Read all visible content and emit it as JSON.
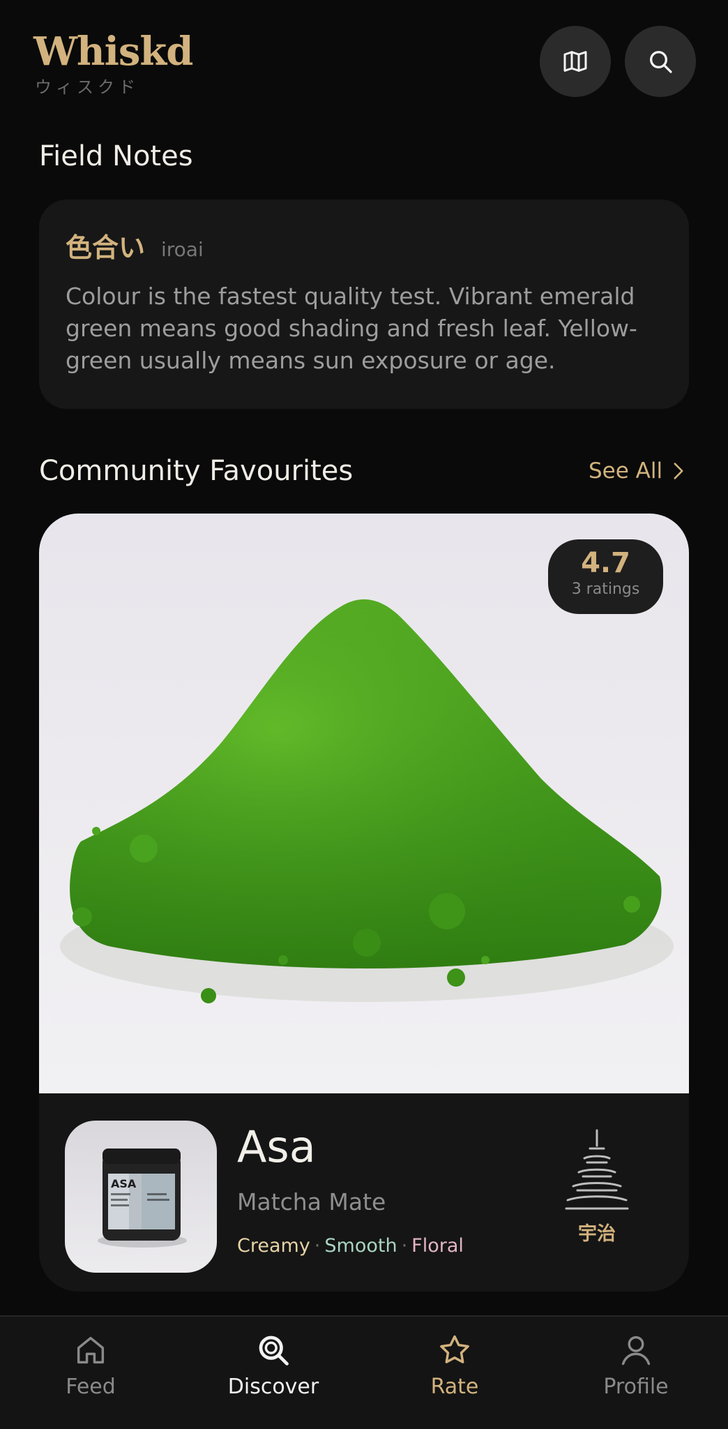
{
  "header": {
    "logo": "Whiskd",
    "logo_sub": "ウィスクド",
    "map_icon": "map-icon",
    "search_icon": "search-icon"
  },
  "field_notes": {
    "title": "Field Notes",
    "note": {
      "term": "色合い",
      "romaji": "iroai",
      "body": "Colour is the fastest quality test. Vibrant emerald green means good shading and fresh leaf. Yellow-green usually means sun exposure or age."
    }
  },
  "community": {
    "title": "Community Favourites",
    "see_all": "See All",
    "featured": {
      "rating": "4.7",
      "ratings_count": "3 ratings",
      "name": "Asa",
      "brand": "Matcha Mate",
      "tags": [
        {
          "label": "Creamy",
          "color": "#e6d3a6"
        },
        {
          "label": "Smooth",
          "color": "#a9d4c2"
        },
        {
          "label": "Floral",
          "color": "#e2b4c4"
        }
      ],
      "jar_label": "ASA",
      "region": "宇治",
      "region_icon": "pagoda-icon"
    }
  },
  "nav": {
    "items": [
      {
        "label": "Feed",
        "icon": "home-icon",
        "color": "#8a8a8a"
      },
      {
        "label": "Discover",
        "icon": "search-icon",
        "color": "#f2f2f2",
        "active": true
      },
      {
        "label": "Rate",
        "icon": "star-icon",
        "color": "#d2b27e"
      },
      {
        "label": "Profile",
        "icon": "user-icon",
        "color": "#8a8a8a"
      }
    ]
  },
  "colors": {
    "accent": "#d2b27e",
    "background": "#0a0a0a",
    "card": "#171717"
  }
}
